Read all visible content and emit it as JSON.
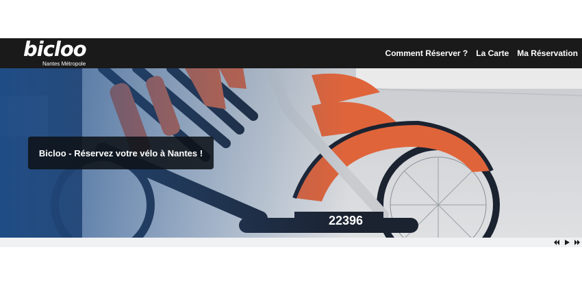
{
  "header": {
    "logo_text": "bicloo",
    "logo_subtitle": "Nantes Métropole",
    "nav": [
      {
        "label": "Comment Réserver ?"
      },
      {
        "label": "La Carte"
      },
      {
        "label": "Ma Réservation"
      }
    ]
  },
  "hero": {
    "caption": "Bicloo - Réservez votre vélo à Nantes !",
    "bike_number": "22396",
    "icons": [
      "prev-icon",
      "play-icon",
      "next-icon"
    ]
  },
  "colors": {
    "navbar": "#1a1a1a",
    "caption_bg": "#0e1218",
    "fender_orange": "#e0643a",
    "bike_frame": "#1b2230",
    "road": "#d9dadc"
  }
}
